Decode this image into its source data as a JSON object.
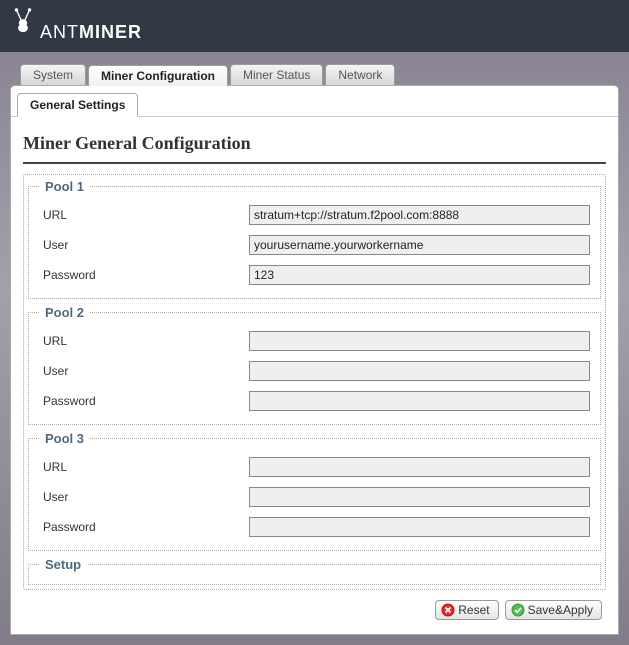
{
  "brand": {
    "part1": "ANT",
    "part2": "MINER"
  },
  "tabs": {
    "primary": [
      {
        "label": "System"
      },
      {
        "label": "Miner Configuration"
      },
      {
        "label": "Miner Status"
      },
      {
        "label": "Network"
      }
    ],
    "sub": [
      {
        "label": "General Settings"
      }
    ]
  },
  "page_title": "Miner General Configuration",
  "pools": {
    "p1": {
      "legend": "Pool 1",
      "url_label": "URL",
      "url_value": "stratum+tcp://stratum.f2pool.com:8888",
      "user_label": "User",
      "user_value": "yourusername.yourworkername",
      "pw_label": "Password",
      "pw_value": "123"
    },
    "p2": {
      "legend": "Pool 2",
      "url_label": "URL",
      "url_value": "",
      "user_label": "User",
      "user_value": "",
      "pw_label": "Password",
      "pw_value": ""
    },
    "p3": {
      "legend": "Pool 3",
      "url_label": "URL",
      "url_value": "",
      "user_label": "User",
      "user_value": "",
      "pw_label": "Password",
      "pw_value": ""
    },
    "setup": {
      "legend": "Setup"
    }
  },
  "buttons": {
    "reset": "Reset",
    "save_apply": "Save&Apply"
  }
}
